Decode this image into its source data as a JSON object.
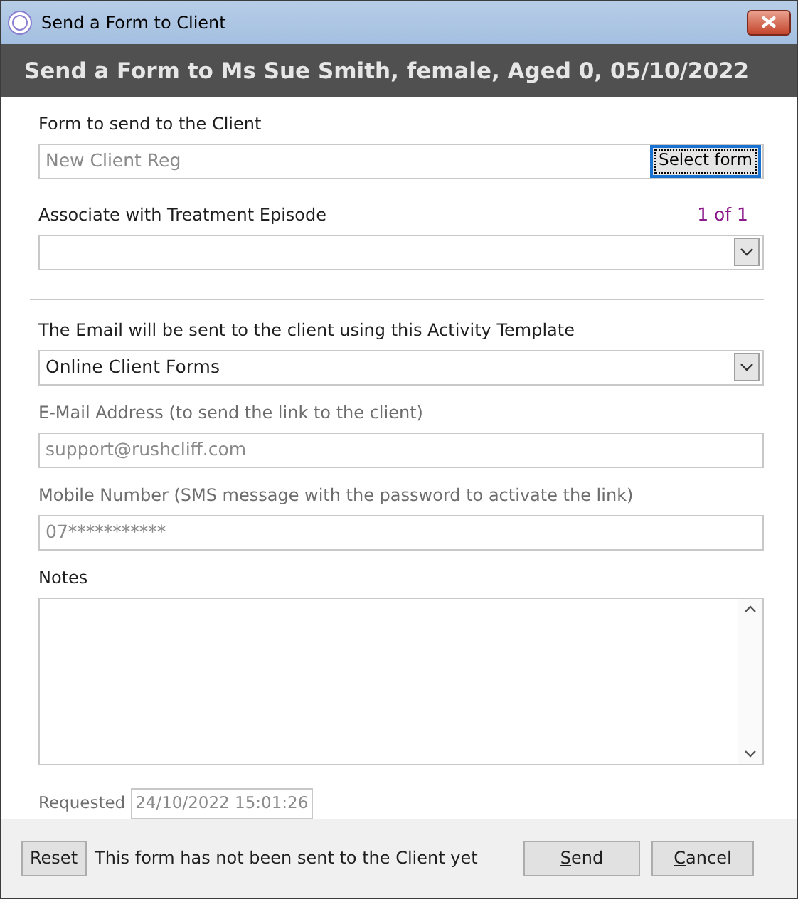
{
  "window": {
    "title": "Send a Form to Client"
  },
  "header": "Send a Form to Ms Sue Smith, female, Aged 0, 05/10/2022",
  "form_field": {
    "label": "Form to send to the Client",
    "value": "New Client Reg",
    "disabled": true,
    "button": "Select form"
  },
  "episode": {
    "label": "Associate with Treatment Episode",
    "counter": "1 of 1"
  },
  "template": {
    "label": "The Email will be sent to the client using this Activity Template",
    "value": "Online Client Forms"
  },
  "fields": [
    {
      "label": "E-Mail Address (to send the link to the client)",
      "value": "support@rushcliff.com",
      "disabled": true
    },
    {
      "label": "Mobile Number (SMS message with the password to activate the link)",
      "value": "07***********",
      "disabled": true
    }
  ],
  "notes": {
    "label": "Notes"
  },
  "requested": {
    "label": "Requested",
    "value": "24/10/2022 15:01:26"
  },
  "footer": {
    "reset": "Reset",
    "status": "This form has not been sent to the Client yet",
    "buttons": [
      {
        "label": "Send",
        "access_key_shown": true
      },
      {
        "label": "Cancel",
        "access_key_shown": true
      }
    ]
  }
}
